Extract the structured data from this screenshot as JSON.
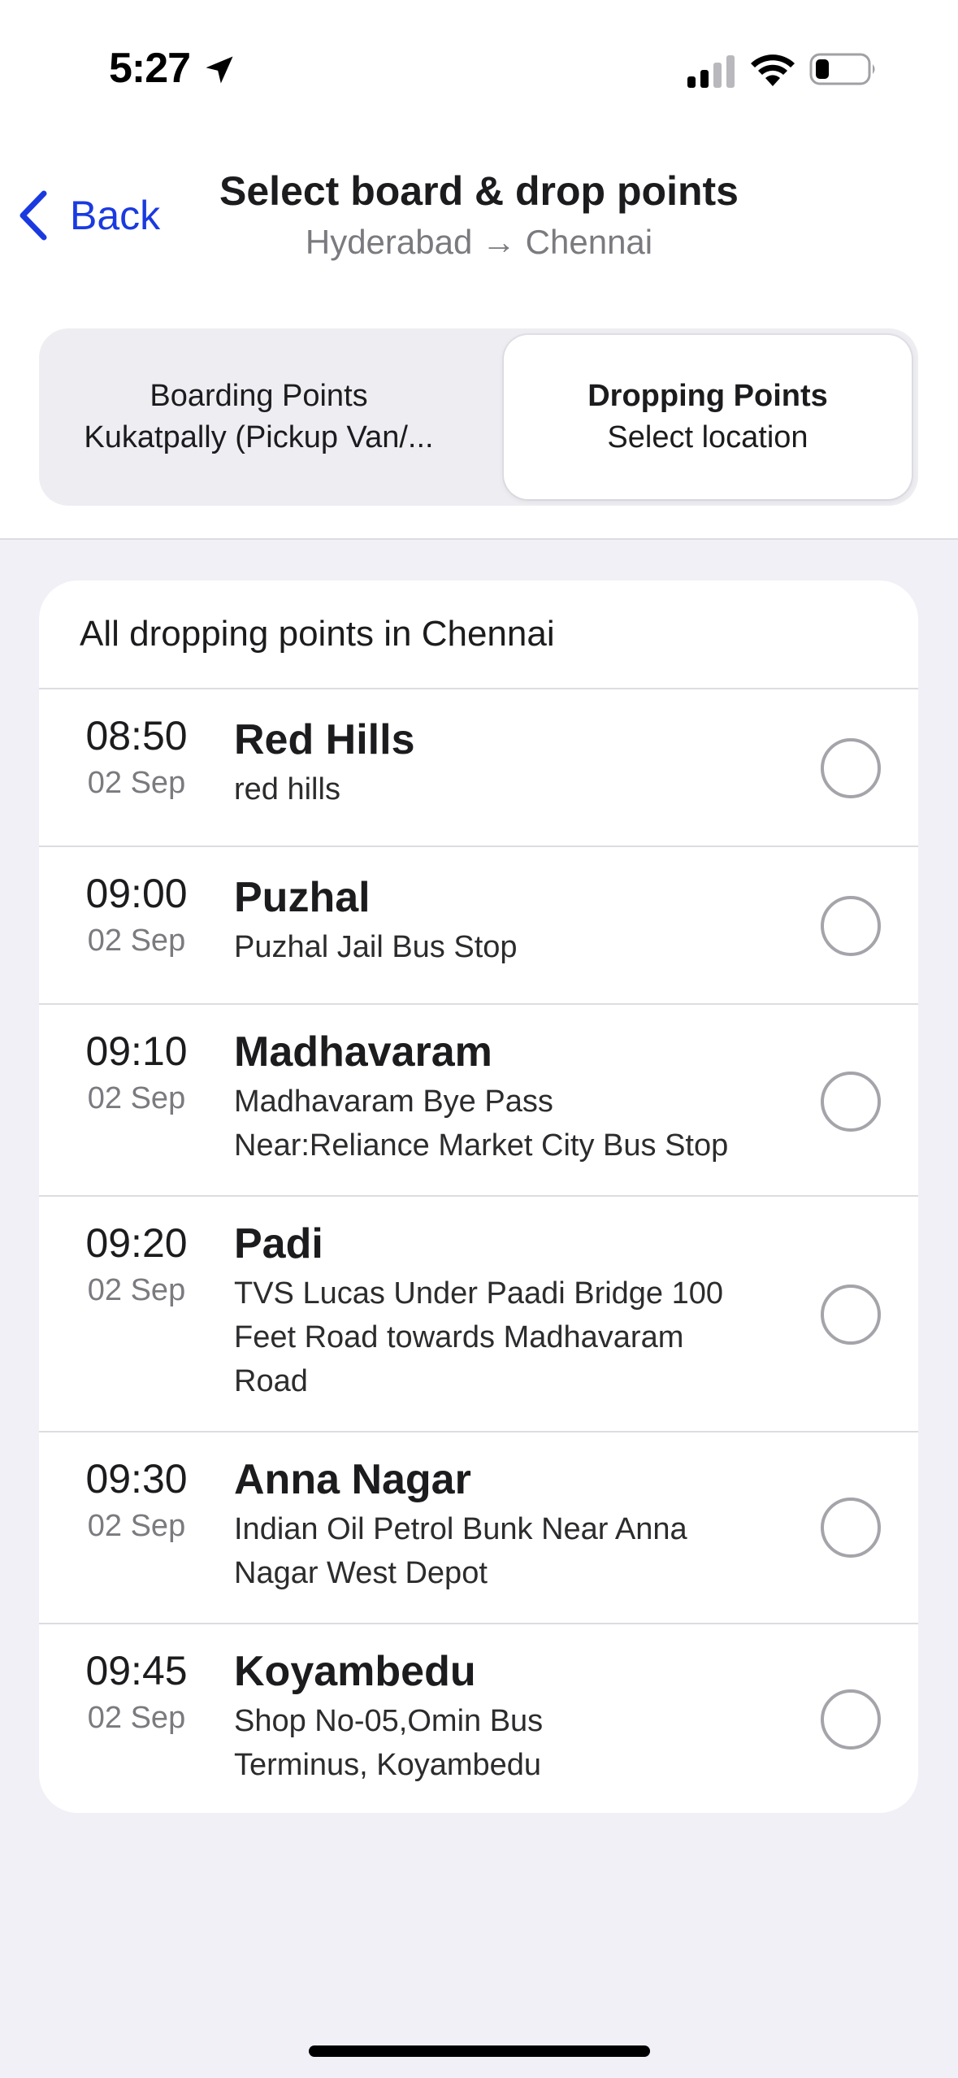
{
  "status_bar": {
    "time": "5:27",
    "icons": [
      "location-arrow-icon",
      "signal-icon",
      "wifi-icon",
      "battery-icon"
    ]
  },
  "nav": {
    "back_label": "Back",
    "title": "Select board & drop points",
    "subtitle": "Hyderabad → Chennai"
  },
  "segments": {
    "boarding": {
      "title": "Boarding Points",
      "value": "Kukatpally (Pickup Van/..."
    },
    "dropping": {
      "title": "Dropping Points",
      "value": "Select location",
      "selected": true
    }
  },
  "list": {
    "header": "All dropping points in Chennai",
    "items": [
      {
        "time": "08:50",
        "date": "02 Sep",
        "name": "Red Hills",
        "address": [
          "red hills"
        ],
        "selected": false
      },
      {
        "time": "09:00",
        "date": "02 Sep",
        "name": "Puzhal",
        "address": [
          "Puzhal Jail Bus Stop"
        ],
        "selected": false
      },
      {
        "time": "09:10",
        "date": "02 Sep",
        "name": "Madhavaram",
        "address": [
          "Madhavaram Bye Pass",
          "Near:Reliance Market City Bus Stop"
        ],
        "selected": false
      },
      {
        "time": "09:20",
        "date": "02 Sep",
        "name": "Padi",
        "address": [
          "TVS Lucas Under Paadi Bridge 100",
          "Feet Road towards Madhavaram",
          "Road"
        ],
        "selected": false
      },
      {
        "time": "09:30",
        "date": "02 Sep",
        "name": "Anna Nagar",
        "address": [
          "Indian Oil Petrol Bunk Near Anna",
          "Nagar West Depot"
        ],
        "selected": false
      },
      {
        "time": "09:45",
        "date": "02 Sep",
        "name": "Koyambedu",
        "address": [
          "Shop No-05,Omin Bus",
          "Terminus, Koyambedu"
        ],
        "selected": false
      }
    ]
  },
  "colors": {
    "accent": "#1a3ae0",
    "background": "#f0f0f6",
    "card": "#ffffff",
    "secondary_text": "#7a7a7f"
  }
}
